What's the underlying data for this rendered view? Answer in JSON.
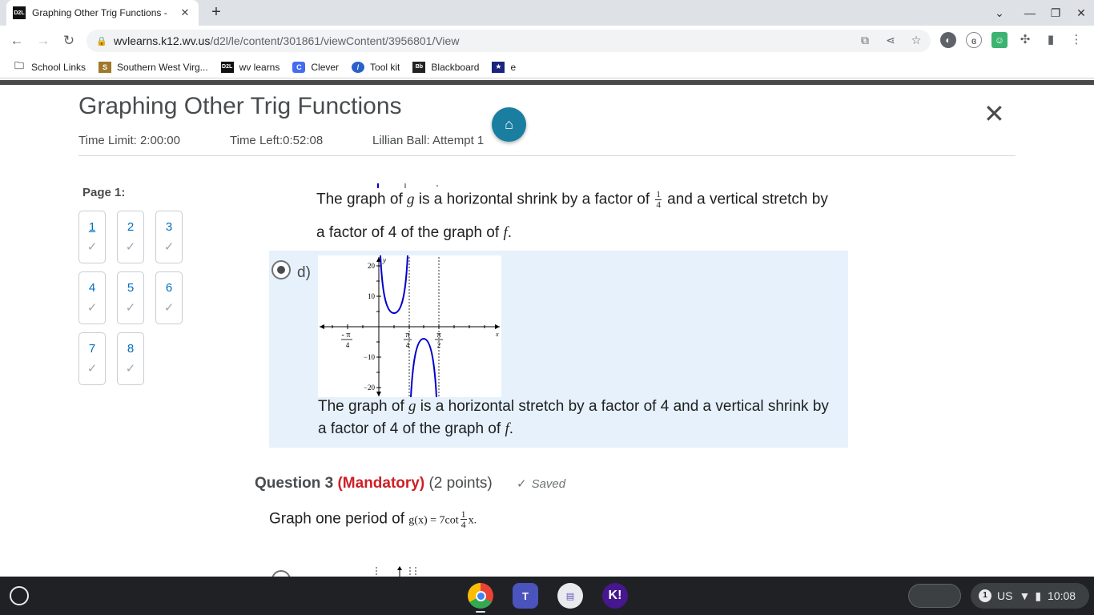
{
  "browser": {
    "tab_title": "Graphing Other Trig Functions - ",
    "tab_favicon": "D2L",
    "url_host": "wvlearns.k12.wv.us",
    "url_path": "/d2l/le/content/301861/viewContent/3956801/View",
    "bookmarks": [
      {
        "label": "School Links",
        "icon": "folder-icon"
      },
      {
        "label": "Southern West Virg...",
        "icon": "southern-wv-icon"
      },
      {
        "label": "wv learns",
        "icon": "d2l-icon"
      },
      {
        "label": "Clever",
        "icon": "clever-icon"
      },
      {
        "label": "Tool kit",
        "icon": "toolkit-icon"
      },
      {
        "label": "Blackboard",
        "icon": "blackboard-icon"
      },
      {
        "label": "e",
        "icon": "star-badge-icon"
      }
    ]
  },
  "quiz": {
    "title": "Graphing Other Trig Functions",
    "time_limit": "Time Limit: 2:00:00",
    "time_left": "Time Left:0:52:08",
    "attempt": "Lillian Ball: Attempt 1",
    "page_label": "Page 1:",
    "questions": [
      "1",
      "2",
      "3",
      "4",
      "5",
      "6",
      "7",
      "8"
    ],
    "current_question": "1"
  },
  "prev_option": {
    "line1_a": "The graph of ",
    "line1_g": "g",
    "line1_b": " is a horizontal shrink by a factor of ",
    "frac_num": "1",
    "frac_den": "4",
    "line1_c": " and a vertical stretch by",
    "line2_a": "a factor of 4 of the graph of ",
    "line2_f": "f",
    "line2_b": "."
  },
  "option_d": {
    "label": "d)",
    "selected": true,
    "text1_a": "The graph of ",
    "text1_g": "g",
    "text1_b": " is a horizontal stretch by a factor of 4 and a vertical shrink by",
    "text2_a": "a factor of 4 of the graph of ",
    "text2_f": "f",
    "text2_b": ".",
    "graph": {
      "y_axis_label": "y",
      "x_axis_label": "x",
      "y_ticks": [
        "20",
        "10",
        "−10",
        "−20"
      ],
      "x_tick_neg_num": "- π",
      "x_tick_neg_den": "4",
      "x_tick1_num": "π",
      "x_tick1_den": "4",
      "x_tick2_num": "π",
      "x_tick2_den": "2",
      "curve_color": "#0000cc"
    }
  },
  "question3": {
    "title": "Question 3",
    "mandatory": "(Mandatory)",
    "points": "(2 points)",
    "saved": "Saved",
    "prompt": "Graph one period of ",
    "func_lhs": "g(x) = 7cot",
    "func_frac_num": "1",
    "func_frac_den": "4",
    "func_rhs": "x."
  },
  "taskbar": {
    "apps": [
      "Chrome",
      "Teams",
      "Files",
      "Kahoot"
    ],
    "notification_count": "1",
    "keyboard": "US",
    "time": "10:08"
  }
}
